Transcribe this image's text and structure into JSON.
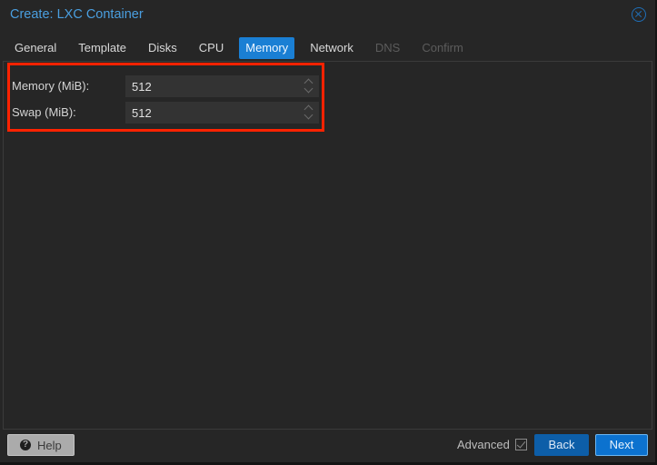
{
  "window": {
    "title": "Create: LXC Container",
    "close_icon": "close-circle-icon"
  },
  "tabs": [
    {
      "label": "General",
      "state": "normal"
    },
    {
      "label": "Template",
      "state": "normal"
    },
    {
      "label": "Disks",
      "state": "normal"
    },
    {
      "label": "CPU",
      "state": "normal"
    },
    {
      "label": "Memory",
      "state": "active"
    },
    {
      "label": "Network",
      "state": "normal"
    },
    {
      "label": "DNS",
      "state": "disabled"
    },
    {
      "label": "Confirm",
      "state": "disabled"
    }
  ],
  "form": {
    "memory": {
      "label": "Memory (MiB):",
      "value": "512"
    },
    "swap": {
      "label": "Swap (MiB):",
      "value": "512"
    }
  },
  "footer": {
    "help_label": "Help",
    "help_icon": "question-circle-icon",
    "advanced_label": "Advanced",
    "advanced_checked": true,
    "back_label": "Back",
    "next_label": "Next"
  },
  "colors": {
    "accent": "#1a7fd4",
    "highlight_box": "#ff2200",
    "title": "#4a9fe0"
  }
}
